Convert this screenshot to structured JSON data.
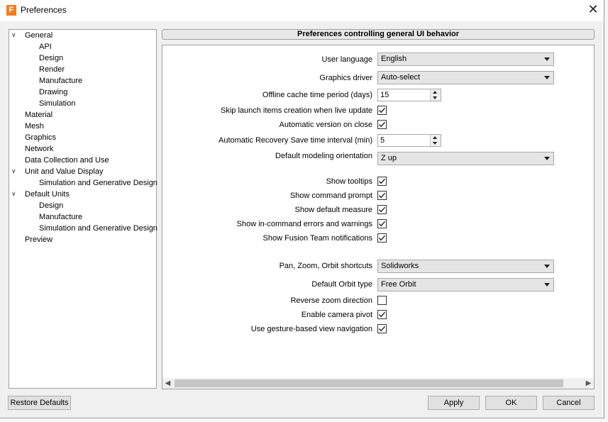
{
  "window": {
    "title": "Preferences",
    "icon_letter": "F",
    "close_icon": "✕"
  },
  "tree": {
    "items": [
      {
        "label": "General",
        "expanded": true
      },
      {
        "label": "API"
      },
      {
        "label": "Design"
      },
      {
        "label": "Render"
      },
      {
        "label": "Manufacture"
      },
      {
        "label": "Drawing"
      },
      {
        "label": "Simulation"
      },
      {
        "label": "Material"
      },
      {
        "label": "Mesh"
      },
      {
        "label": "Graphics"
      },
      {
        "label": "Network"
      },
      {
        "label": "Data Collection and Use"
      },
      {
        "label": "Unit and Value Display",
        "expanded": true
      },
      {
        "label": "Simulation and Generative Design"
      },
      {
        "label": "Default Units",
        "expanded": true
      },
      {
        "label": "Design"
      },
      {
        "label": "Manufacture"
      },
      {
        "label": "Simulation and Generative Design"
      },
      {
        "label": "Preview"
      }
    ],
    "expand_icon": "chevron-down-icon"
  },
  "panel": {
    "title": "Preferences controlling general UI behavior",
    "user_language": {
      "label": "User language",
      "value": "English"
    },
    "graphics_driver": {
      "label": "Graphics driver",
      "value": "Auto-select"
    },
    "offline_cache": {
      "label": "Offline cache time period (days)",
      "value": "15"
    },
    "skip_launch": {
      "label": "Skip launch items creation when live update",
      "checked": true
    },
    "auto_version": {
      "label": "Automatic version on close",
      "checked": true
    },
    "auto_recovery": {
      "label": "Automatic Recovery Save time interval (min)",
      "value": "5"
    },
    "modeling_orientation": {
      "label": "Default modeling orientation",
      "value": "Z up"
    },
    "show_tooltips": {
      "label": "Show tooltips",
      "checked": true
    },
    "show_command_prompt": {
      "label": "Show command prompt",
      "checked": true
    },
    "show_default_measure": {
      "label": "Show default measure",
      "checked": true
    },
    "show_errors": {
      "label": "Show in-command errors and warnings",
      "checked": true
    },
    "show_team_notifications": {
      "label": "Show Fusion Team notifications",
      "checked": true
    },
    "pzo_shortcuts": {
      "label": "Pan, Zoom, Orbit shortcuts",
      "value": "Solidworks"
    },
    "orbit_type": {
      "label": "Default Orbit type",
      "value": "Free Orbit"
    },
    "reverse_zoom": {
      "label": "Reverse zoom direction",
      "checked": false
    },
    "camera_pivot": {
      "label": "Enable camera pivot",
      "checked": true
    },
    "gesture_nav": {
      "label": "Use gesture-based view navigation",
      "checked": true
    }
  },
  "scrollbar": {
    "left_arrow": "◀",
    "right_arrow": "▶"
  },
  "buttons": {
    "restore_defaults": "Restore Defaults",
    "apply": "Apply",
    "ok": "OK",
    "cancel": "Cancel"
  }
}
